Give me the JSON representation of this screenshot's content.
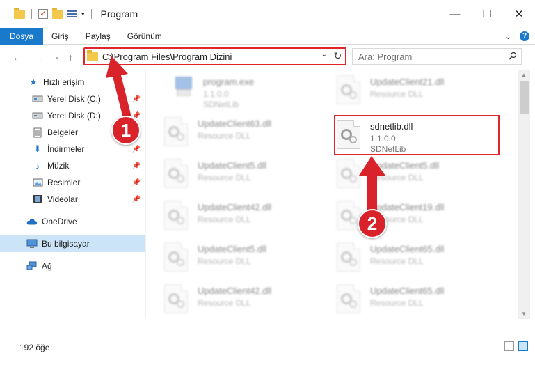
{
  "window": {
    "title": "Program",
    "minimize": "—",
    "maximize": "☐",
    "close": "✕"
  },
  "ribbon": {
    "tabs": [
      "Dosya",
      "Giriş",
      "Paylaş",
      "Görünüm"
    ],
    "expand": "⌄",
    "help": "?"
  },
  "navbar": {
    "back": "←",
    "forward": "→",
    "recent": "⌄",
    "up": "↑",
    "address_path": "C:\\Program Files\\Program Dizini",
    "address_chevron": "⌄",
    "refresh": "↻",
    "search_placeholder": "Ara: Program"
  },
  "sidebar": {
    "items": [
      {
        "label": "Hızlı erişim",
        "icon": "star-icon"
      },
      {
        "label": "Yerel Disk (C:)",
        "icon": "disk-icon",
        "pinned": true
      },
      {
        "label": "Yerel Disk (D:)",
        "icon": "disk-icon",
        "pinned": true
      },
      {
        "label": "Belgeler",
        "icon": "document-icon",
        "pinned": true
      },
      {
        "label": "İndirmeler",
        "icon": "download-icon",
        "pinned": true
      },
      {
        "label": "Müzik",
        "icon": "music-icon",
        "pinned": true
      },
      {
        "label": "Resimler",
        "icon": "pictures-icon",
        "pinned": true
      },
      {
        "label": "Videolar",
        "icon": "video-icon",
        "pinned": true
      },
      {
        "label": "OneDrive",
        "icon": "cloud-icon"
      },
      {
        "label": "Bu bilgisayar",
        "icon": "computer-icon",
        "selected": true
      },
      {
        "label": "Ağ",
        "icon": "network-icon"
      }
    ],
    "pin_glyph": "📌"
  },
  "files": {
    "left": [
      {
        "name": "program.exe",
        "line1": "1.1.0.0",
        "line2": "SDNetLib"
      },
      {
        "name": "UpdateClient63.dll",
        "line1": "Resource DLL"
      },
      {
        "name": "UpdateClient5.dll",
        "line1": "Resource DLL"
      },
      {
        "name": "UpdateClient42.dll",
        "line1": "Resource DLL"
      },
      {
        "name": "UpdateClient5.dll",
        "line1": "Resource DLL"
      },
      {
        "name": "UpdateClient42.dll",
        "line1": "Resource DLL"
      }
    ],
    "right": [
      {
        "name": "UpdateClient21.dll",
        "line1": "Resource DLL"
      },
      {
        "name": "sdnetlib.dll",
        "line1": "1.1.0.0",
        "line2": "SDNetLib"
      },
      {
        "name": "UpdateClient5.dll",
        "line1": "Resource DLL"
      },
      {
        "name": "UpdateClient19.dll",
        "line1": "Resource DLL"
      },
      {
        "name": "UpdateClient65.dll",
        "line1": "Resource DLL"
      },
      {
        "name": "UpdateClient65.dll",
        "line1": "Resource DLL"
      }
    ]
  },
  "status": {
    "count": "192 öğe"
  },
  "annotations": {
    "badge1": "1",
    "badge2": "2",
    "color": "#d9232a"
  }
}
